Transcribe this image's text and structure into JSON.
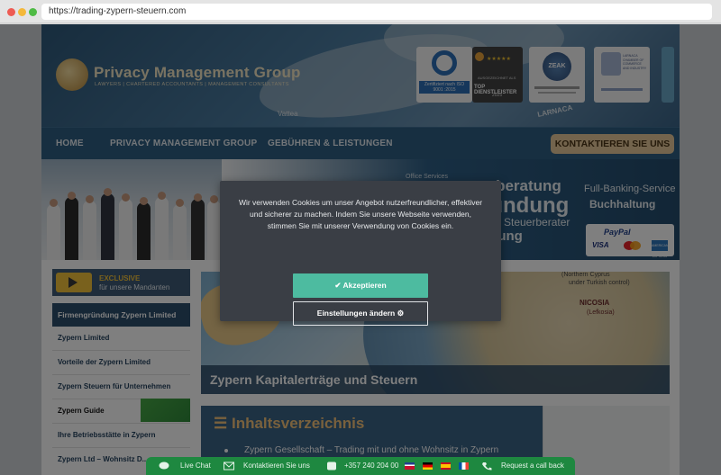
{
  "browser": {
    "url": "https://trading-zypern-steuern.com"
  },
  "header": {
    "logo_name": "Privacy Management Group",
    "logo_tagline": "LAWYERS | CHARTERED ACCOUNTANTS | MANAGEMENT CONSULTANTS",
    "map_place": "Vattea",
    "map_place_2": "LARNACA",
    "badges": {
      "iso_text": "Zertifiziert nach ISO 9001 :2015",
      "rating_stars": "★★★★★",
      "rating_label": "AUSGEZEICHNET ALS",
      "rating_main": "TOP DIENSTLEISTER",
      "rating_year": "2025",
      "seal_text": "ZEAK",
      "chamber_text": "LARNACA CHAMBER OF COMMERCE AND INDUSTRY"
    }
  },
  "nav": {
    "items": [
      "HOME",
      "PRIVACY MANAGEMENT GROUP",
      "GEBÜHREN & LEISTUNGEN"
    ],
    "cta": "KONTAKTIEREN SIE UNS"
  },
  "banner": {
    "line1": "erberatung",
    "line2": "ründung",
    "line3": "Steuerberater",
    "line4": "ierung",
    "office": "Office Services",
    "service1": "Full-Banking-Service",
    "service2": "Buchhaltung",
    "payment": {
      "paypal": "PayPal",
      "visa": "VISA",
      "amex": "AMERICAN EXPRESS"
    }
  },
  "sidebar": {
    "exclusive_title": "EXCLUSIVE",
    "exclusive_sub": "für unsere Mandanten",
    "section": "Firmengründung Zypern Limited",
    "links": [
      "Zypern Limited",
      "Vorteile der Zypern Limited",
      "Zypern Steuern für Unternehmen",
      "Zypern Guide",
      "Ihre Betriebsstätte in Zypern",
      "Zypern Ltd – Wohnsitz D..."
    ]
  },
  "hero": {
    "title": "Zypern Kapitalerträge und Steuern",
    "map_label_1": "(Northern Cyprus",
    "map_label_2": "under Turkish control)",
    "city": "NICOSIA",
    "city_sub": "(Lefkosia)"
  },
  "toc": {
    "title": "Inhaltsverzeichnis",
    "items": [
      "Zypern Gesellschaft – Trading mit und ohne Wohnsitz in Zypern"
    ]
  },
  "cookie": {
    "message": "Wir verwenden Cookies um unser Angebot nutzerfreundlicher, effektiver und sicherer zu machen. Indem Sie unsere Webseite verwenden, stimmen Sie mit unserer Verwendung von Cookies ein.",
    "accept": "Akzeptieren",
    "settings": "Einstellungen ändern"
  },
  "bottom_bar": {
    "live_chat": "Live Chat",
    "contact": "Kontaktieren Sie uns",
    "phone": "+357 240 204 00",
    "callback": "Request a call back"
  },
  "colors": {
    "accent": "#4dbba0",
    "nav": "#2f5e82",
    "cta": "#e7c99a",
    "bottom_bar": "#1e8840"
  }
}
